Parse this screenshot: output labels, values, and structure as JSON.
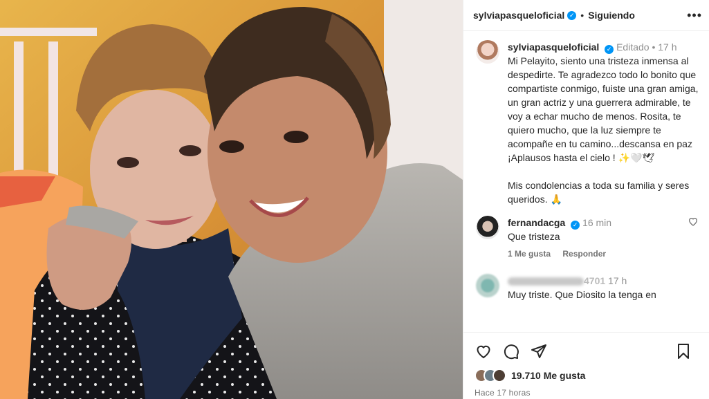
{
  "header": {
    "username": "sylviapasqueloficial",
    "separator": "•",
    "follow_label": "Siguiendo",
    "more_icon": "more-options-icon"
  },
  "caption": {
    "username": "sylviapasqueloficial",
    "edited_label": "Editado",
    "separator": "•",
    "time": "17 h",
    "text_1": "Mi Pelayito, siento una tristeza inmensa al despedirte. Te agradezco todo lo bonito que compartiste conmigo, fuiste una gran amiga, un gran actriz y una guerrera admirable, te voy a echar mucho de menos. Rosita, te quiero mucho, que la luz siempre te acompañe en tu camino...descansa en paz ¡Aplausos hasta el cielo ! ✨🤍🕊",
    "text_2": "Mis condolencias a toda su familia y seres queridos. 🙏"
  },
  "comments": [
    {
      "username": "fernandacga",
      "time": "16 min",
      "text": "Que tristeza",
      "likes_label": "1 Me gusta",
      "reply_label": "Responder"
    },
    {
      "username_suffix": "4701",
      "time": "17 h",
      "text": "Muy triste. Que Diosito la tenga en"
    }
  ],
  "actions": {
    "like_count": "19.710 Me gusta",
    "posted_ago": "Hace 17 horas"
  },
  "colors": {
    "verified": "#0095f6",
    "text": "#262626",
    "muted": "#737373"
  }
}
